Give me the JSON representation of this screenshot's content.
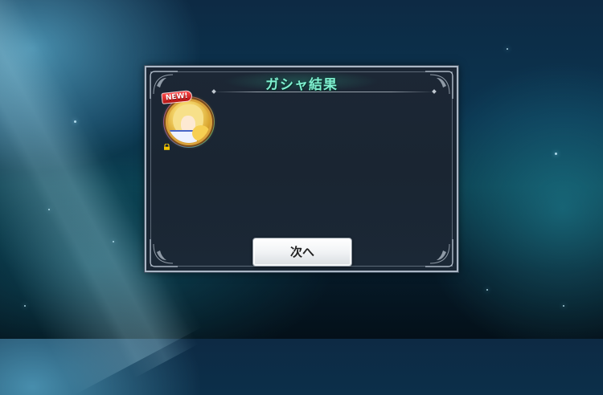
{
  "dialog": {
    "title": "ガシャ結果",
    "results": [
      {
        "badge": "NEW!",
        "locked": true,
        "icon": "character-portrait"
      }
    ],
    "next_label": "次へ"
  },
  "colors": {
    "title": "#7ff0d0",
    "badge": "#d01a1a",
    "frame": "#aab7c6",
    "panel": "#1c2735"
  },
  "icons": [
    "lock-icon",
    "ornament-corner-icon"
  ]
}
